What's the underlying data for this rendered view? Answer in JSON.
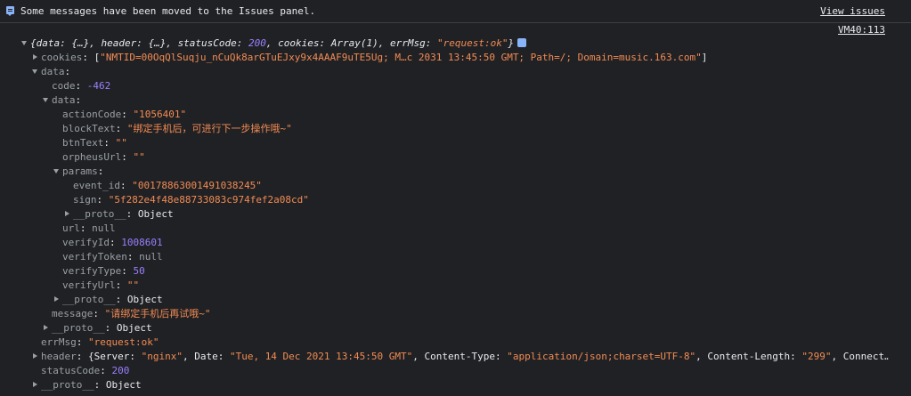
{
  "banner": {
    "text": "Some messages have been moved to the Issues panel.",
    "link": "View issues"
  },
  "source": "VM40:113",
  "summary": {
    "open": "{data: {…}, header: {…}, statusCode: ",
    "statusCode": "200",
    "mid": ", cookies: Array(1), errMsg: ",
    "errMsg": "\"request:ok\"",
    "close": "}"
  },
  "cookies": {
    "key": "cookies",
    "value": "\"NMTID=00OqQlSuqju_nCuQk8arGTuEJxy9x4AAAF9uTE5Ug; M…c 2031 13:45:50 GMT; Path=/; Domain=music.163.com\""
  },
  "data": {
    "key": "data",
    "code_key": "code",
    "code": "-462",
    "inner_key": "data",
    "actionCode_key": "actionCode",
    "actionCode": "\"1056401\"",
    "blockText_key": "blockText",
    "blockText": "\"绑定手机后，可进行下一步操作哦~\"",
    "btnText_key": "btnText",
    "btnText": "\"\"",
    "orpheusUrl_key": "orpheusUrl",
    "orpheusUrl": "\"\"",
    "params_key": "params",
    "event_id_key": "event_id",
    "event_id": "\"00178863001491038245\"",
    "sign_key": "sign",
    "sign": "\"5f282e4f48e88733083c974fef2a08cd\"",
    "proto_key": "__proto__",
    "proto_val": "Object",
    "url_key": "url",
    "url": "null",
    "verifyId_key": "verifyId",
    "verifyId": "1008601",
    "verifyToken_key": "verifyToken",
    "verifyToken": "null",
    "verifyType_key": "verifyType",
    "verifyType": "50",
    "verifyUrl_key": "verifyUrl",
    "verifyUrl": "\"\"",
    "message_key": "message",
    "message": "\"请绑定手机后再试哦~\""
  },
  "errMsg": {
    "key": "errMsg",
    "value": "\"request:ok\""
  },
  "header": {
    "key": "header",
    "open": "{Server: ",
    "server": "\"nginx\"",
    "date_key": ", Date: ",
    "date": "\"Tue, 14 Dec 2021 13:45:50 GMT\"",
    "ct_key": ", Content-Type: ",
    "ct": "\"application/json;charset=UTF-8\"",
    "cl_key": ", Content-Length: ",
    "cl": "\"299\"",
    "tail": ", Connect…"
  },
  "statusCode": {
    "key": "statusCode",
    "value": "200"
  },
  "colon": ": ",
  "colors": {
    "background": "#202124",
    "key": "#9aa0a6",
    "string": "#f28b54",
    "number": "#9980ff",
    "text": "#e8eaed",
    "accent": "#8ab4f8"
  }
}
